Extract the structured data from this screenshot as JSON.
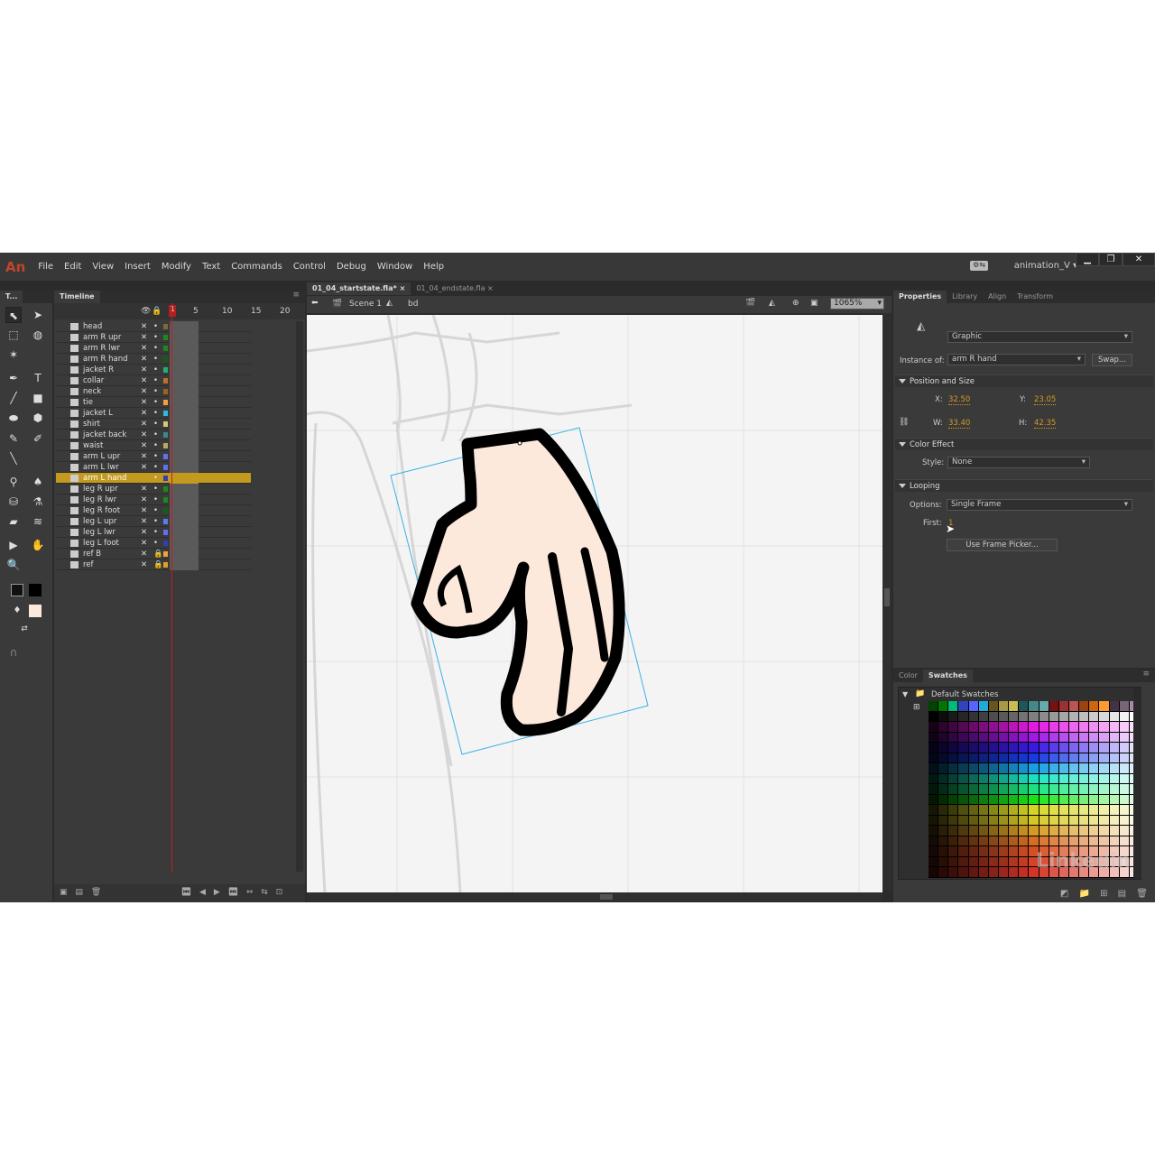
{
  "app": {
    "logo": "An",
    "workspace": "animation_V",
    "window_buttons": [
      "▁",
      "❐",
      "✕"
    ]
  },
  "menu": [
    "File",
    "Edit",
    "View",
    "Insert",
    "Modify",
    "Text",
    "Commands",
    "Control",
    "Debug",
    "Window",
    "Help"
  ],
  "tools_panel": {
    "title": "T..."
  },
  "timeline": {
    "title": "Timeline",
    "frame_numbers": [
      "1",
      "5",
      "10",
      "15",
      "20"
    ],
    "current_frame": "1",
    "layers": [
      {
        "name": "head",
        "color": "#7a6a3a"
      },
      {
        "name": "arm R upr",
        "color": "#1a8a1a"
      },
      {
        "name": "arm R lwr",
        "color": "#1a8a1a"
      },
      {
        "name": "arm R hand",
        "color": "#145f14"
      },
      {
        "name": "jacket R",
        "color": "#20b070"
      },
      {
        "name": "collar",
        "color": "#c07020"
      },
      {
        "name": "neck",
        "color": "#a06020"
      },
      {
        "name": "tie",
        "color": "#f0a040"
      },
      {
        "name": "jacket L",
        "color": "#30b8d8"
      },
      {
        "name": "shirt",
        "color": "#d8c870"
      },
      {
        "name": "jacket back",
        "color": "#3a8888"
      },
      {
        "name": "waist",
        "color": "#b8a860"
      },
      {
        "name": "arm L upr",
        "color": "#6070f0"
      },
      {
        "name": "arm L lwr",
        "color": "#6070f0"
      },
      {
        "name": "arm L hand",
        "color": "#3040b0",
        "selected": true
      },
      {
        "name": "leg R upr",
        "color": "#1a8a1a"
      },
      {
        "name": "leg R lwr",
        "color": "#1a8a1a"
      },
      {
        "name": "leg R foot",
        "color": "#145f14"
      },
      {
        "name": "leg L upr",
        "color": "#5080f0"
      },
      {
        "name": "leg L lwr",
        "color": "#6070f0"
      },
      {
        "name": "leg L foot",
        "color": "#3040b0"
      },
      {
        "name": "ref B",
        "color": "#f0a040",
        "locked": true,
        "guide": true
      },
      {
        "name": "ref",
        "color": "#e0a020",
        "locked": true,
        "guide": true
      }
    ]
  },
  "document": {
    "tabs": [
      {
        "label": "01_04_startstate.fla*",
        "active": true
      },
      {
        "label": "01_04_endstate.fla",
        "active": false
      }
    ],
    "breadcrumb": {
      "scene": "Scene 1",
      "symbol": "bd"
    },
    "zoom": "1065%"
  },
  "properties": {
    "tabs": [
      "Properties",
      "Library",
      "Align",
      "Transform"
    ],
    "symbol_type": "Graphic",
    "instance_of_label": "Instance of:",
    "instance_of": "arm R hand",
    "swap_label": "Swap...",
    "position_size": {
      "title": "Position and Size",
      "x_label": "X:",
      "x": "32.50",
      "y_label": "Y:",
      "y": "23.05",
      "w_label": "W:",
      "w": "33.40",
      "h_label": "H:",
      "h": "42.35"
    },
    "color_effect": {
      "title": "Color Effect",
      "style_label": "Style:",
      "style": "None"
    },
    "looping": {
      "title": "Looping",
      "options_label": "Options:",
      "options": "Single Frame",
      "first_label": "First:",
      "first": "1",
      "frame_picker_label": "Use Frame Picker..."
    }
  },
  "swatches_panel": {
    "tabs": [
      "Color",
      "Swatches"
    ],
    "folder": "Default Swatches",
    "top_row": [
      "#004400",
      "#007700",
      "#00bb77",
      "#3344bb",
      "#5566ff",
      "#22aadd",
      "#665522",
      "#aa9944",
      "#ccbb55",
      "#225555",
      "#448888",
      "#66aaaa",
      "#771111",
      "#993333",
      "#bb5555",
      "#994411",
      "#cc6611",
      "#ff9933",
      "#443344",
      "#776677",
      "#aa88aa"
    ]
  },
  "watermark": "Linkedin"
}
